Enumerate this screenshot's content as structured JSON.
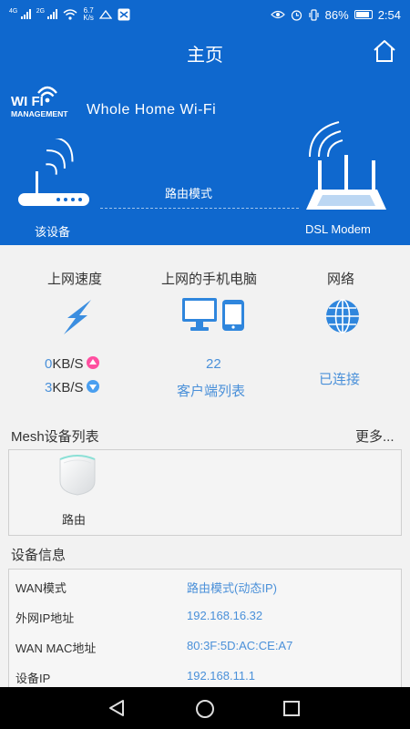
{
  "status_bar": {
    "net_4g": "4G",
    "net_2g": "2G",
    "speed_value": "6.7",
    "speed_unit": "K/s",
    "battery": "86%",
    "time": "2:54"
  },
  "header": {
    "title": "主页",
    "home_icon": "home-icon"
  },
  "brand": {
    "logo_line1": "WI  FI",
    "logo_line2": "MANAGEMENT",
    "name": "Whole Home Wi-Fi"
  },
  "topology": {
    "device_label": "该设备",
    "mode_label": "路由模式",
    "modem_label": "DSL Modem"
  },
  "stats": {
    "speed": {
      "title": "上网速度",
      "up_value": "0",
      "down_value": "3",
      "unit": "KB/S"
    },
    "clients": {
      "title": "上网的手机电脑",
      "count": "22",
      "link": "客户端列表"
    },
    "network": {
      "title": "网络",
      "status": "已连接"
    }
  },
  "mesh": {
    "title": "Mesh设备列表",
    "more": "更多...",
    "items": [
      {
        "label": "路由"
      }
    ]
  },
  "device_info": {
    "title": "设备信息",
    "rows": [
      {
        "key": "WAN模式",
        "value": "路由模式(动态IP)"
      },
      {
        "key": "外网IP地址",
        "value": "192.168.16.32"
      },
      {
        "key": "WAN MAC地址",
        "value": "80:3F:5D:AC:CE:A7"
      },
      {
        "key": "设备IP",
        "value": "192.168.11.1"
      }
    ]
  },
  "colors": {
    "primary_blue": "#0f68ce",
    "accent_blue": "#4a90d9",
    "upload_pink": "#ff4fa0",
    "download_blue": "#4a9ff0"
  }
}
